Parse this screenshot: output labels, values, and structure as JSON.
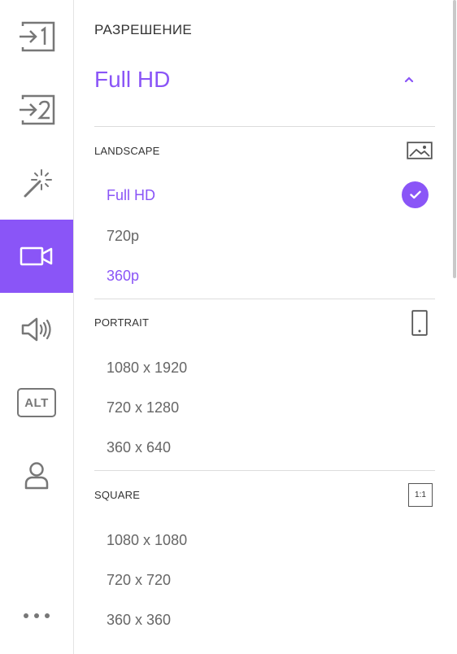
{
  "colors": {
    "accent": "#8a55f7",
    "icon_gray": "#777777",
    "text_gray": "#666666"
  },
  "sidebar": {
    "items": [
      {
        "icon": "input-1-icon"
      },
      {
        "icon": "input-2-icon"
      },
      {
        "icon": "magic-wand-icon"
      },
      {
        "icon": "video-camera-icon",
        "active": true
      },
      {
        "icon": "speaker-icon"
      },
      {
        "icon": "alt-text-icon",
        "label": "ALT"
      },
      {
        "icon": "user-icon"
      },
      {
        "icon": "more-dots-icon"
      }
    ]
  },
  "resolution": {
    "title": "РАЗРЕШЕНИЕ",
    "current": "Full HD"
  },
  "sections": {
    "landscape": {
      "title": "LANDSCAPE",
      "icon": "image-icon",
      "options": [
        "Full HD",
        "720p",
        "360p"
      ],
      "selected": "Full HD"
    },
    "portrait": {
      "title": "PORTRAIT",
      "icon": "phone-icon",
      "options": [
        "1080 x 1920",
        "720 x 1280",
        "360 x 640"
      ]
    },
    "square": {
      "title": "SQUARE",
      "icon": "square-ratio-icon",
      "icon_label": "1:1",
      "options": [
        "1080 x 1080",
        "720 x 720",
        "360 x 360"
      ]
    }
  }
}
